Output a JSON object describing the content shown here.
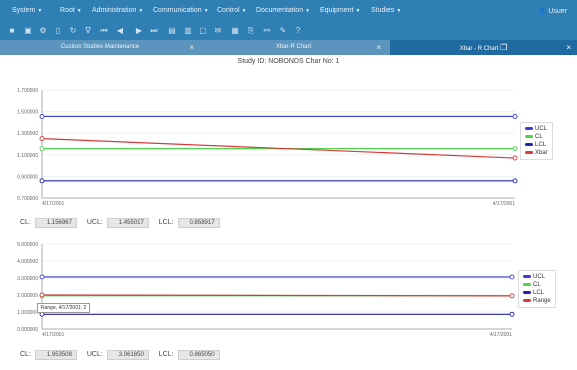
{
  "menu": {
    "items": [
      "System",
      "Root",
      "Administration",
      "Communication",
      "Control",
      "Documentation",
      "Equipment",
      "Studies"
    ],
    "user": "Usuer"
  },
  "tabs": [
    {
      "label": "Custom Studies Maintenance"
    },
    {
      "label": "Xbar-R Chart"
    },
    {
      "label": "Xbar - R Chart"
    }
  ],
  "study_title": "Study ID: NOBONDS Char No: 1",
  "chart_data": [
    {
      "type": "line",
      "y_ticks": [
        "1.700000",
        "1.500000",
        "1.300000",
        "1.100000",
        "0.900000",
        "0.700000"
      ],
      "ylim": [
        0.7,
        1.7
      ],
      "x_labels": [
        "4/17/2001",
        "4/17/2001"
      ],
      "series": [
        {
          "name": "UCL",
          "color": "#3b3bd6",
          "values": [
            1.455017,
            1.455017
          ]
        },
        {
          "name": "CL",
          "color": "#4fd34f",
          "values": [
            1.156967,
            1.156967
          ]
        },
        {
          "name": "LCL",
          "color": "#2222aa",
          "values": [
            0.858917,
            0.858917
          ]
        },
        {
          "name": "Xbar",
          "color": "#d63b3b",
          "values": [
            1.25,
            1.07
          ]
        }
      ]
    },
    {
      "type": "line",
      "y_ticks": [
        "5.000000",
        "4.000000",
        "3.000000",
        "2.000000",
        "1.000000",
        "0.000000"
      ],
      "ylim": [
        0,
        5
      ],
      "x_labels": [
        "4/17/2001",
        "4/17/2001"
      ],
      "series": [
        {
          "name": "UCL",
          "color": "#3b3bd6",
          "values": [
            3.06185,
            3.06185
          ]
        },
        {
          "name": "CL",
          "color": "#4fd34f",
          "values": [
            1.953508,
            1.953508
          ]
        },
        {
          "name": "LCL",
          "color": "#2222aa",
          "values": [
            0.86505,
            0.86505
          ]
        },
        {
          "name": "Range",
          "color": "#d63b3b",
          "values": [
            2,
            1.95
          ]
        }
      ]
    }
  ],
  "stats1": {
    "cl_label": "CL:",
    "cl": "1.156967",
    "ucl_label": "UCL:",
    "ucl": "1.455017",
    "lcl_label": "LCL:",
    "lcl": "0.858917"
  },
  "stats2": {
    "cl_label": "CL:",
    "cl": "1.953508",
    "ucl_label": "UCL:",
    "ucl": "3.061850",
    "lcl_label": "LCL:",
    "lcl": "0.865050"
  },
  "tooltip": "Range, 4/17/2001: 2"
}
